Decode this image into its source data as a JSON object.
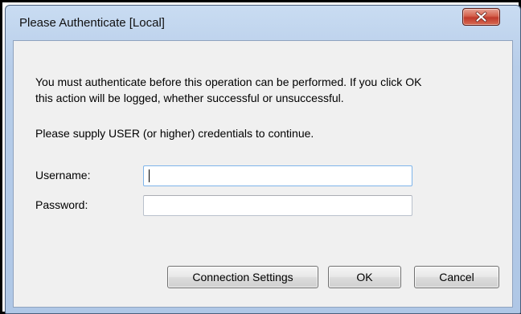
{
  "window": {
    "title": "Please Authenticate [Local]",
    "close_icon": "close-x-icon",
    "close_color": "#c0392b"
  },
  "message": {
    "line1": "You must authenticate before this operation can be performed. If you click OK",
    "line2": "this action will be logged, whether successful or unsuccessful.",
    "supply": "Please supply USER (or higher) credentials to continue."
  },
  "form": {
    "username_label": "Username:",
    "username_value": "",
    "password_label": "Password:",
    "password_value": ""
  },
  "buttons": {
    "connection_settings": "Connection Settings",
    "ok": "OK",
    "cancel": "Cancel"
  }
}
